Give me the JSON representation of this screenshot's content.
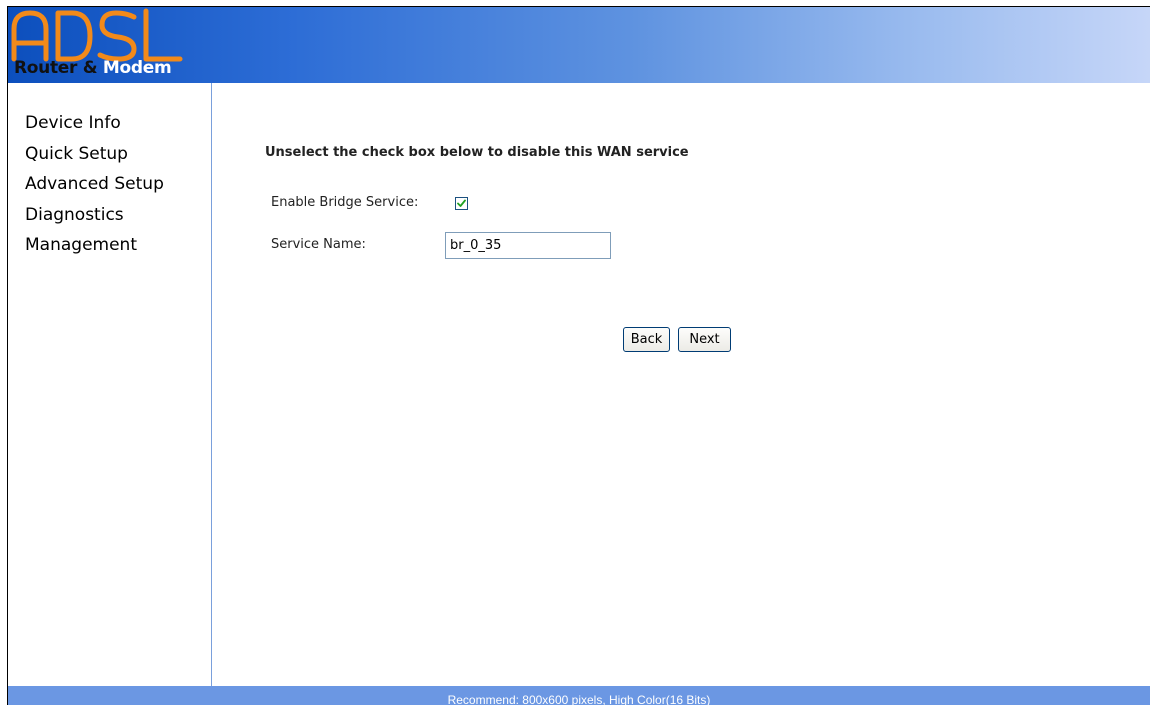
{
  "header": {
    "logo_letters": "ADSL",
    "logo_text_dark": "Router &",
    "logo_text_light": " Modem"
  },
  "sidebar": {
    "items": [
      {
        "label": "Device Info"
      },
      {
        "label": "Quick Setup"
      },
      {
        "label": "Advanced Setup"
      },
      {
        "label": "Diagnostics"
      },
      {
        "label": "Management"
      }
    ]
  },
  "main": {
    "instruction": "Unselect the check box below to disable this WAN service",
    "bridge_label": "Enable Bridge Service:",
    "bridge_checked": true,
    "service_name_label": "Service Name:",
    "service_name_value": "br_0_35",
    "back_label": "Back",
    "next_label": "Next"
  },
  "footer": {
    "text": "Recommend: 800x600 pixels, High Color(16 Bits)"
  },
  "colors": {
    "header_gradient_start": "#0c4fbd",
    "header_gradient_end": "#c6d6f8",
    "footer_bg": "#6b97e3",
    "logo_orange": "#f28a1a"
  }
}
